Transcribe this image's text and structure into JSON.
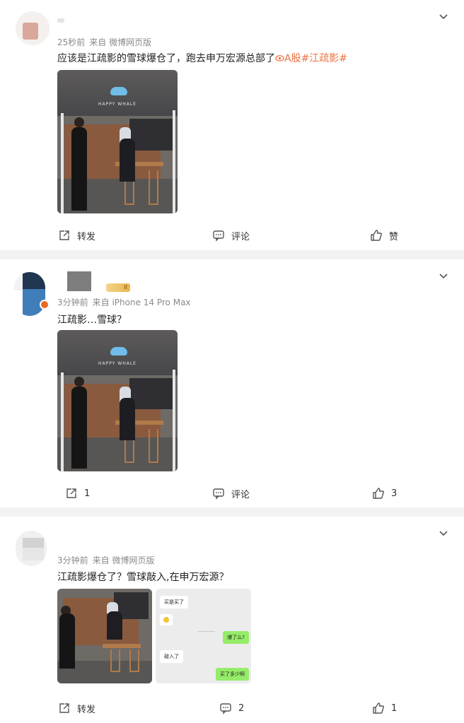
{
  "colors": {
    "accent": "#eb7340",
    "meta": "#8a8a8a",
    "background": "#f2f2f2"
  },
  "posts": [
    {
      "time": "25秒前",
      "source": "来自 微博网页版",
      "text": "应该是江疏影的雪球爆仓了，跑去申万宏源总部了",
      "tag_stock": "A股",
      "tag_topic": "#江疏影#",
      "media_text": "HAPPY WHALE",
      "actions": {
        "repost": "转发",
        "comment": "评论",
        "like": "赞"
      }
    },
    {
      "time": "3分钟前",
      "source": "来自 iPhone 14 Pro Max",
      "level": "II",
      "text": "江疏影…雪球？",
      "media_text": "HAPPY WHALE",
      "actions": {
        "repost": "1",
        "comment": "评论",
        "like": "3"
      }
    },
    {
      "time": "3分钟前",
      "source": "来自 微博网页版",
      "text": "江疏影爆仓了？雪球敲入,在申万宏源？",
      "chat": {
        "msg1": "买是买了",
        "msg2": "爆了么?",
        "msg3": "敲入了",
        "msg4": "买了多少啊"
      },
      "actions": {
        "repost": "转发",
        "comment": "2",
        "like": "1"
      }
    }
  ],
  "icons": {
    "more": "chevron-down-icon",
    "repost": "share-icon",
    "comment": "comment-icon",
    "like": "thumbs-up-icon",
    "stock": "stock-eye-icon"
  }
}
